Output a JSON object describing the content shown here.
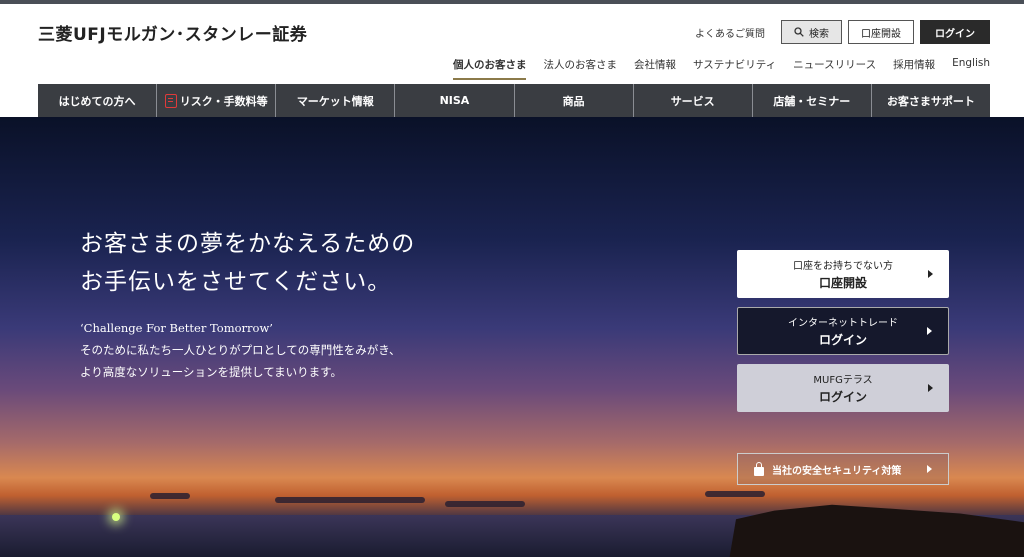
{
  "header": {
    "logo": "三菱UFJモルガン･スタンレー証券",
    "faq": "よくあるご質問",
    "search": "検索",
    "open_account": "口座開設",
    "login": "ログイン"
  },
  "subnav": [
    "個人のお客さま",
    "法人のお客さま",
    "会社情報",
    "サステナビリティ",
    "ニュースリリース",
    "採用情報",
    "English"
  ],
  "mainnav": [
    "はじめての方へ",
    "リスク・手数料等",
    "マーケット情報",
    "NISA",
    "商品",
    "サービス",
    "店舗・セミナー",
    "お客さまサポート"
  ],
  "hero": {
    "headline_1": "お客さまの夢をかなえるための",
    "headline_2": "お手伝いをさせてください。",
    "tag_1": "‘Challenge For Better Tomorrow’",
    "tag_2": "そのために私たち一人ひとりがプロとしての専門性をみがき、",
    "tag_3": "より高度なソリューションを提供してまいります。"
  },
  "cta": {
    "open": {
      "line1": "口座をお持ちでない方",
      "line2": "口座開設"
    },
    "net": {
      "line1": "インターネットトレード",
      "line2": "ログイン"
    },
    "mufg": {
      "line1": "MUFGテラス",
      "line2": "ログイン"
    }
  },
  "security": "当社の安全セキュリティ対策",
  "colors": {
    "nav_bg": "#3a3d42",
    "accent_underline": "#8b7a4a",
    "risk_icon": "#e03a3a"
  },
  "icons": {
    "search": "search-icon",
    "risk": "document-icon",
    "lock": "lock-icon"
  }
}
